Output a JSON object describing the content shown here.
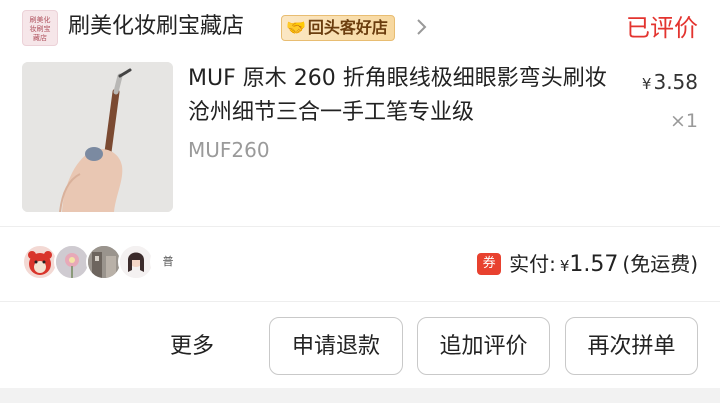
{
  "shop": {
    "logo_text": [
      "刷美化",
      "妆刷宝",
      "藏店"
    ],
    "name": "刷美化妆刷宝藏店",
    "badge": "回头客好店",
    "badge_icon": "handshake-icon",
    "chevron_icon": "chevron-right-icon"
  },
  "order": {
    "status": "已评价",
    "status_color": "#e3342f"
  },
  "product": {
    "title": "MUF 原木 260 折角眼线极细眼影弯头刷妆沧州细节三合一手工笔专业级",
    "sku": "MUF260",
    "price_symbol": "¥",
    "price": "3.58",
    "quantity": "×1"
  },
  "reviewers": {
    "avatar_icons": [
      "red-bear-avatar",
      "flower-avatar",
      "street-avatar",
      "girl-avatar",
      "cartoon-avatar"
    ],
    "last_avatar_text": "普"
  },
  "payment": {
    "coupon_icon_text": "券",
    "label": "实付:",
    "symbol": "¥",
    "amount": "1.57",
    "shipping": "(免运费)"
  },
  "actions": {
    "more": "更多",
    "refund": "申请退款",
    "add_review": "追加评价",
    "reorder": "再次拼单"
  }
}
